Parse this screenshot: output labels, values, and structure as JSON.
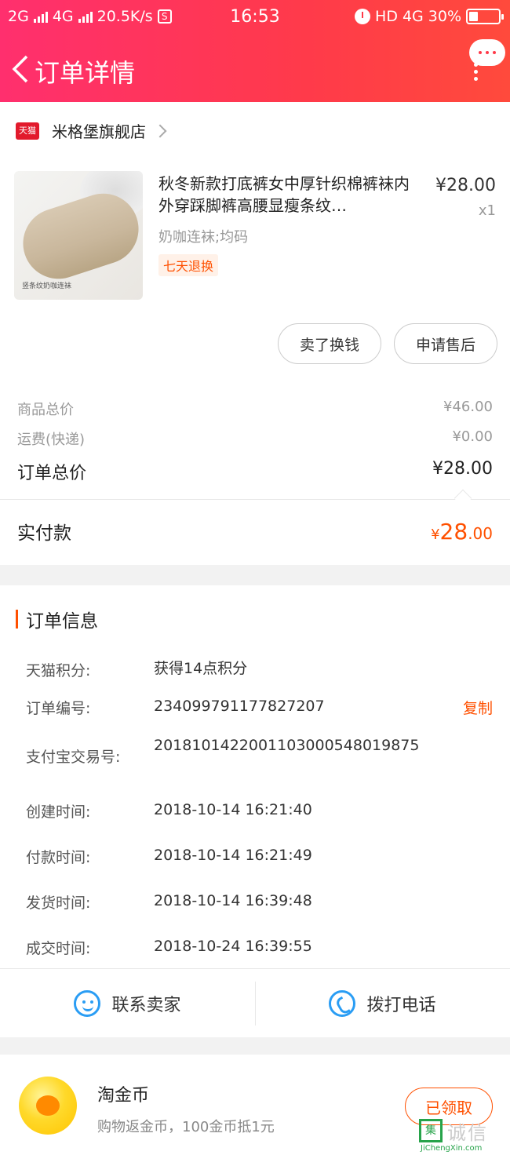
{
  "status_bar": {
    "net1": "2G",
    "net2": "4G",
    "speed": "20.5K/s",
    "s_icon": "S",
    "time": "16:53",
    "hd": "HD",
    "net3": "4G",
    "battery": "30%",
    "battery_level": 0.3
  },
  "nav": {
    "title": "订单详情"
  },
  "store": {
    "badge": "天猫",
    "name": "米格堡旗舰店"
  },
  "product": {
    "title": "秋冬新款打底裤女中厚针织棉裤袜内外穿踩脚裤高腰显瘦条纹…",
    "price": "¥28.00",
    "qty": "x1",
    "sku": "奶咖连袜;均码",
    "tag": "七天退换",
    "image_caption": "竖条纹奶咖连袜"
  },
  "actions": {
    "sell": "卖了换钱",
    "after_sale": "申请售后"
  },
  "fees": {
    "goods_label": "商品总价",
    "goods_value": "¥46.00",
    "ship_label": "运费(快递)",
    "ship_value": "¥0.00",
    "total_label": "订单总价",
    "total_value": "¥28.00",
    "paid_label": "实付款",
    "paid_currency": "¥",
    "paid_int": "28",
    "paid_dec": ".00"
  },
  "order_info": {
    "title": "订单信息",
    "rows": [
      {
        "key": "天猫积分:",
        "value": "获得14点积分"
      },
      {
        "key": "订单编号:",
        "value": "234099791177827207"
      },
      {
        "key": "支付宝交易号:",
        "value": "2018101422001103000548019875"
      },
      {
        "key": "创建时间:",
        "value": "2018-10-14 16:21:40"
      },
      {
        "key": "付款时间:",
        "value": "2018-10-14 16:21:49"
      },
      {
        "key": "发货时间:",
        "value": "2018-10-14 16:39:48"
      },
      {
        "key": "成交时间:",
        "value": "2018-10-24 16:39:55"
      }
    ],
    "copy_label": "复制"
  },
  "contact": {
    "seller": "联系卖家",
    "phone": "拨打电话"
  },
  "coin": {
    "title": "淘金币",
    "desc": "购物返金币，100金币抵1元",
    "button": "已领取"
  },
  "watermark": {
    "box": "集",
    "text": "诚信",
    "url": "JiChengXin.com"
  },
  "colors": {
    "header_from": "#ff2f6e",
    "header_to": "#ff4a3c",
    "accent": "#ff5000",
    "icon_blue": "#2a9df4"
  }
}
